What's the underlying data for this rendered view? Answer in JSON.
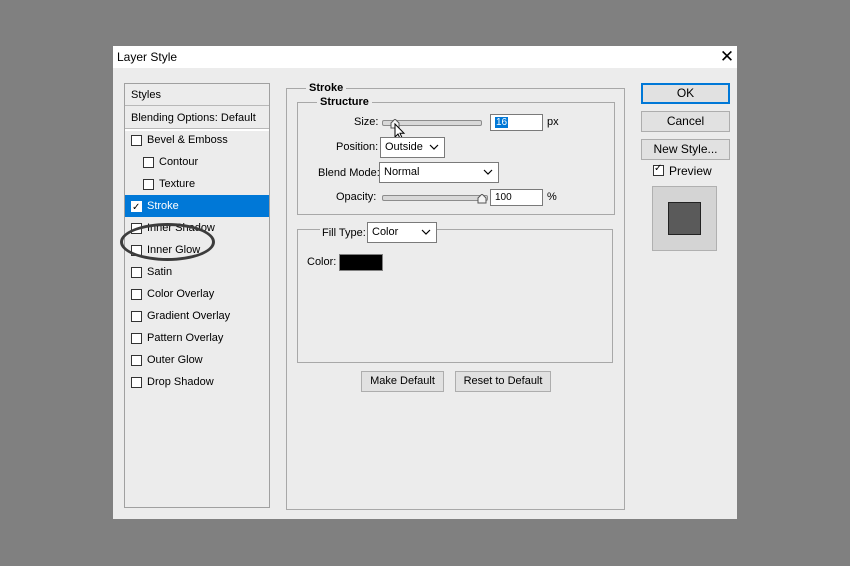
{
  "window": {
    "title": "Layer Style",
    "close_icon": "close-icon"
  },
  "stylelist": {
    "header_styles": "Styles",
    "header_blending": "Blending Options: Default",
    "items": [
      {
        "label": "Bevel & Emboss",
        "checked": false
      },
      {
        "label": "Contour",
        "checked": false
      },
      {
        "label": "Texture",
        "checked": false
      },
      {
        "label": "Stroke",
        "checked": true
      },
      {
        "label": "Inner Shadow",
        "checked": false
      },
      {
        "label": "Inner Glow",
        "checked": false
      },
      {
        "label": "Satin",
        "checked": false
      },
      {
        "label": "Color Overlay",
        "checked": false
      },
      {
        "label": "Gradient Overlay",
        "checked": false
      },
      {
        "label": "Pattern Overlay",
        "checked": false
      },
      {
        "label": "Outer Glow",
        "checked": false
      },
      {
        "label": "Drop Shadow",
        "checked": false
      }
    ]
  },
  "stroke": {
    "group_title": "Stroke",
    "structure_title": "Structure",
    "size_label": "Size:",
    "size_value": "16",
    "size_unit": "px",
    "position_label": "Position:",
    "position_value": "Outside",
    "blend_label": "Blend Mode:",
    "blend_value": "Normal",
    "opacity_label": "Opacity:",
    "opacity_value": "100",
    "opacity_unit": "%",
    "fill_type_label": "Fill Type:",
    "fill_type_value": "Color",
    "color_label": "Color:",
    "color_swatch": "#000000",
    "make_default": "Make Default",
    "reset_default": "Reset to Default"
  },
  "buttons": {
    "ok": "OK",
    "cancel": "Cancel",
    "new_style": "New Style...",
    "preview_label": "Preview",
    "preview_checked": true
  }
}
